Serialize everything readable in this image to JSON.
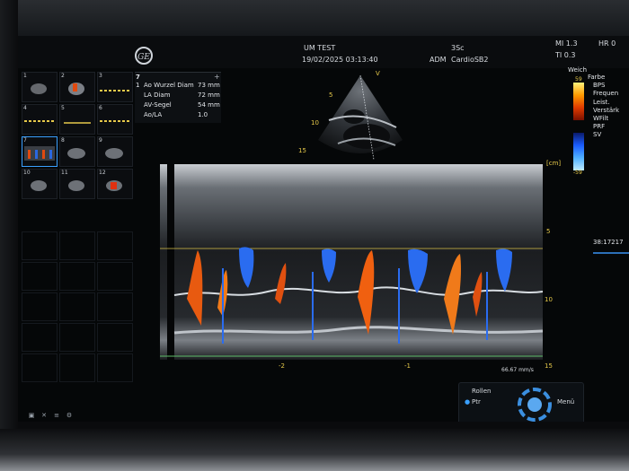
{
  "header": {
    "patient_name": "UM TEST",
    "datetime": "19/02/2025 03:13:40",
    "probe": "3Sc",
    "operator": "ADM",
    "preset": "CardioSB2",
    "mi": "MI 1.3",
    "ti": "TI 0.3",
    "hr": "HR 0"
  },
  "thumbnails": [
    {
      "num": "1"
    },
    {
      "num": "2"
    },
    {
      "num": "3"
    },
    {
      "num": "4"
    },
    {
      "num": "5"
    },
    {
      "num": "6"
    },
    {
      "num": "7"
    },
    {
      "num": "8"
    },
    {
      "num": "9"
    },
    {
      "num": "10"
    },
    {
      "num": "11"
    },
    {
      "num": "12"
    }
  ],
  "measurements": {
    "index": "7",
    "set_label": "1",
    "rows": [
      {
        "label": "Ao Wurzel Diam",
        "value": "73 mm"
      },
      {
        "label": "LA Diam",
        "value": "72 mm"
      },
      {
        "label": "AV-Segel",
        "value": "54 mm"
      },
      {
        "label": "Ao/LA",
        "value": "1.0"
      }
    ]
  },
  "sector_depth_labels": [
    "5",
    "10",
    "15"
  ],
  "sector_marker": "V",
  "color_bar": {
    "title": "Weich",
    "top": "59",
    "bottom": "-59",
    "warm": "#ff5a00",
    "cool": "#1a6cff"
  },
  "menu_items": [
    "Farbe",
    "BPS",
    "Frequen",
    "Leist.",
    "Verstärk",
    "WFilt",
    "PRF",
    "SV"
  ],
  "mmode": {
    "unit": "[cm]",
    "depth_labels": [
      "5",
      "10",
      "15"
    ],
    "time_labels": [
      "-2",
      "-1"
    ],
    "sweep_speed": "66.67 mm/s"
  },
  "side_value": "38:17217",
  "controls": {
    "roll_label": "Rollen",
    "ptr_label": "Ptr",
    "menu_label": "Menü"
  },
  "toolbar_icons": [
    "image-icon",
    "delete-icon",
    "list-icon",
    "settings-icon"
  ]
}
